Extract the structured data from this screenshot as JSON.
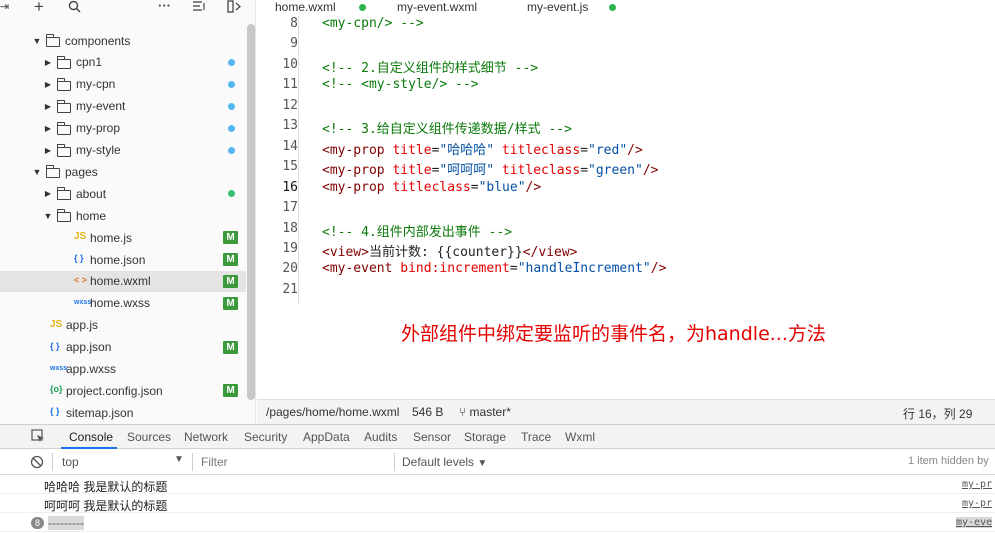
{
  "sidebar": {
    "toolbar": {
      "add_symbol": "+",
      "search_icon": "search-icon",
      "more_symbol": "···"
    },
    "tree": [
      {
        "label": "components",
        "kind": "folder-open",
        "depth": 0,
        "arrow": "down",
        "marker": ""
      },
      {
        "label": "cpn1",
        "kind": "folder",
        "depth": 1,
        "arrow": "right",
        "marker": "dot-blue"
      },
      {
        "label": "my-cpn",
        "kind": "folder",
        "depth": 1,
        "arrow": "right",
        "marker": "dot-blue"
      },
      {
        "label": "my-event",
        "kind": "folder",
        "depth": 1,
        "arrow": "right",
        "marker": "dot-blue"
      },
      {
        "label": "my-prop",
        "kind": "folder",
        "depth": 1,
        "arrow": "right",
        "marker": "dot-blue"
      },
      {
        "label": "my-style",
        "kind": "folder",
        "depth": 1,
        "arrow": "right",
        "marker": "dot-blue"
      },
      {
        "label": "pages",
        "kind": "folder-open",
        "depth": 0,
        "arrow": "down",
        "marker": ""
      },
      {
        "label": "about",
        "kind": "folder",
        "depth": 1,
        "arrow": "right",
        "marker": "dot-green"
      },
      {
        "label": "home",
        "kind": "folder-open",
        "depth": 1,
        "arrow": "down",
        "marker": ""
      },
      {
        "label": "home.js",
        "kind": "js",
        "depth": 2,
        "arrow": "",
        "marker": "M"
      },
      {
        "label": "home.json",
        "kind": "json",
        "depth": 2,
        "arrow": "",
        "marker": "M"
      },
      {
        "label": "home.wxml",
        "kind": "wxml",
        "depth": 2,
        "arrow": "",
        "marker": "M",
        "selected": true
      },
      {
        "label": "home.wxss",
        "kind": "wxss",
        "depth": 2,
        "arrow": "",
        "marker": "M"
      },
      {
        "label": "app.js",
        "kind": "js",
        "depth": 0,
        "arrow": "",
        "marker": ""
      },
      {
        "label": "app.json",
        "kind": "json",
        "depth": 0,
        "arrow": "",
        "marker": "M"
      },
      {
        "label": "app.wxss",
        "kind": "wxss",
        "depth": 0,
        "arrow": "",
        "marker": ""
      },
      {
        "label": "project.config.json",
        "kind": "config",
        "depth": 0,
        "arrow": "",
        "marker": "M"
      },
      {
        "label": "sitemap.json",
        "kind": "json",
        "depth": 0,
        "arrow": "",
        "marker": ""
      }
    ],
    "icon_text": {
      "js": "JS",
      "json": "{ }",
      "wxml": "< >",
      "wxss": "wxss",
      "config": "{o}"
    }
  },
  "tabs": [
    {
      "label": "home.wxml",
      "active": true
    },
    {
      "label": "my-event.wxml",
      "active": false
    },
    {
      "label": "my-event.js",
      "active": false
    }
  ],
  "code_lines": [
    {
      "n": "8",
      "tokens": [
        [
          "c-cm",
          "<my-cpn/> -->"
        ]
      ]
    },
    {
      "n": "9",
      "tokens": []
    },
    {
      "n": "10",
      "tokens": [
        [
          "c-cm",
          "<!-- 2.自定义组件的样式细节 -->"
        ]
      ]
    },
    {
      "n": "11",
      "tokens": [
        [
          "c-cm",
          "<!-- <my-style/> -->"
        ]
      ]
    },
    {
      "n": "12",
      "tokens": []
    },
    {
      "n": "13",
      "tokens": [
        [
          "c-cm",
          "<!-- 3.给自定义组件传递数据/样式 -->"
        ]
      ]
    },
    {
      "n": "14",
      "tokens": [
        [
          "c-tag",
          "<my-prop "
        ],
        [
          "c-attr",
          "title"
        ],
        [
          "c-txt",
          "="
        ],
        [
          "c-str",
          "\"哈哈哈\""
        ],
        [
          "c-txt",
          " "
        ],
        [
          "c-attr",
          "titleclass"
        ],
        [
          "c-txt",
          "="
        ],
        [
          "c-str",
          "\"red\""
        ],
        [
          "c-tag",
          "/>"
        ]
      ]
    },
    {
      "n": "15",
      "tokens": [
        [
          "c-tag",
          "<my-prop "
        ],
        [
          "c-attr",
          "title"
        ],
        [
          "c-txt",
          "="
        ],
        [
          "c-str",
          "\"呵呵呵\""
        ],
        [
          "c-txt",
          " "
        ],
        [
          "c-attr",
          "titleclass"
        ],
        [
          "c-txt",
          "="
        ],
        [
          "c-str",
          "\"green\""
        ],
        [
          "c-tag",
          "/>"
        ]
      ]
    },
    {
      "n": "16",
      "tokens": [
        [
          "c-tag",
          "<my-prop "
        ],
        [
          "c-attr",
          "titleclass"
        ],
        [
          "c-txt",
          "="
        ],
        [
          "c-str",
          "\"blue\""
        ],
        [
          "c-tag",
          "/>"
        ]
      ]
    },
    {
      "n": "17",
      "tokens": []
    },
    {
      "n": "18",
      "tokens": [
        [
          "c-cm",
          "<!-- 4.组件内部发出事件 -->"
        ]
      ]
    },
    {
      "n": "19",
      "tokens": [
        [
          "c-tag",
          "<view>"
        ],
        [
          "c-txt",
          "当前计数: {{counter}}"
        ],
        [
          "c-tag",
          "</view>"
        ]
      ]
    },
    {
      "n": "20",
      "tokens": [
        [
          "c-tag",
          "<my-event "
        ],
        [
          "c-attr",
          "bind:increment"
        ],
        [
          "c-txt",
          "="
        ],
        [
          "c-str",
          "\"handleIncrement\""
        ],
        [
          "c-tag",
          "/>"
        ]
      ]
    },
    {
      "n": "21",
      "tokens": []
    }
  ],
  "annotation": "外部组件中绑定要监听的事件名，为handle...方法",
  "statusbar": {
    "path": "/pages/home/home.wxml",
    "size": "546 B",
    "branch": "master*",
    "position": "行 16，列 29"
  },
  "devtools": {
    "tabs": [
      "Console",
      "Sources",
      "Network",
      "Security",
      "AppData",
      "Audits",
      "Sensor",
      "Storage",
      "Trace",
      "Wxml"
    ],
    "active_tab": "Console",
    "context": "top",
    "filter_placeholder": "Filter",
    "levels": "Default levels",
    "hidden": "1 item hidden by",
    "console": [
      {
        "msg": "哈哈哈  我是默认的标题",
        "src": "my-pr"
      },
      {
        "msg": "呵呵呵  我是默认的标题",
        "src": "my-pr"
      },
      {
        "msg": "---------",
        "src": "my-eve",
        "count": "8"
      }
    ]
  },
  "colors": {
    "accent": "#1a73e8",
    "modified_badge": "#3c9a3c",
    "dot_blue": "#55b7f0",
    "dot_green": "#38c172",
    "annotation": "#e60000"
  }
}
